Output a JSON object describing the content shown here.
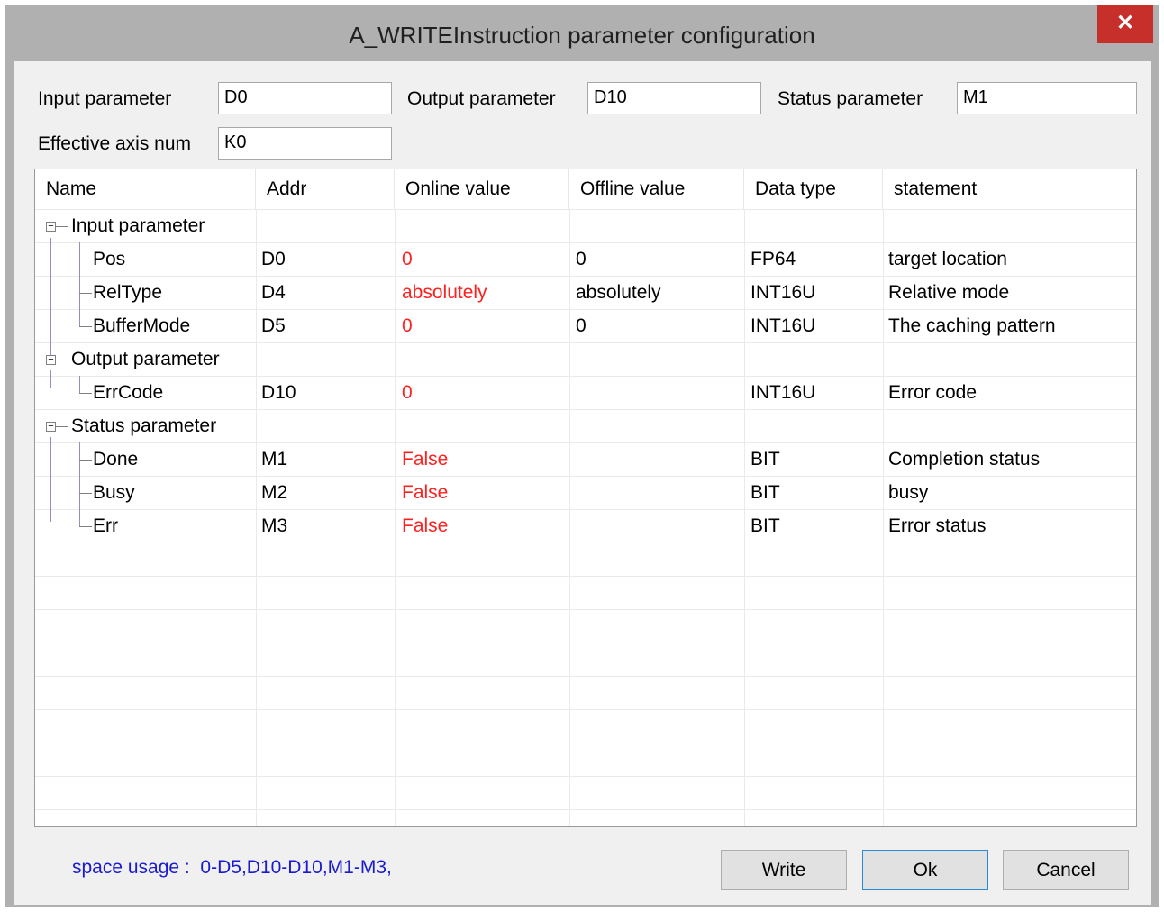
{
  "window": {
    "title": "A_WRITEInstruction parameter configuration",
    "close_glyph": "✕"
  },
  "params": {
    "input_label": "Input parameter",
    "input_value": "D0",
    "output_label": "Output parameter",
    "output_value": "D10",
    "status_label": "Status parameter",
    "status_value": "M1",
    "axis_label": "Effective axis num",
    "axis_value": "K0"
  },
  "table": {
    "columns": [
      "Name",
      "Addr",
      "Online value",
      "Offline value",
      "Data type",
      "statement"
    ],
    "groups": [
      {
        "label": "Input parameter",
        "expander": "−"
      },
      {
        "label": "Output parameter",
        "expander": "−"
      },
      {
        "label": "Status parameter",
        "expander": "−"
      }
    ],
    "rows": [
      {
        "name": "Pos",
        "addr": "D0",
        "online": "0",
        "offline": "0",
        "type": "FP64",
        "statement": "target location"
      },
      {
        "name": "RelType",
        "addr": "D4",
        "online": "absolutely",
        "offline": "absolutely",
        "type": "INT16U",
        "statement": "Relative mode"
      },
      {
        "name": "BufferMode",
        "addr": "D5",
        "online": "0",
        "offline": "0",
        "type": "INT16U",
        "statement": "The caching pattern"
      },
      {
        "name": "ErrCode",
        "addr": "D10",
        "online": "0",
        "offline": "",
        "type": "INT16U",
        "statement": "Error code"
      },
      {
        "name": "Done",
        "addr": "M1",
        "online": "False",
        "offline": "",
        "type": "BIT",
        "statement": "Completion status"
      },
      {
        "name": "Busy",
        "addr": "M2",
        "online": "False",
        "offline": "",
        "type": "BIT",
        "statement": "busy"
      },
      {
        "name": "Err",
        "addr": "M3",
        "online": "False",
        "offline": "",
        "type": "BIT",
        "statement": "Error status"
      }
    ]
  },
  "footer": {
    "space_usage": "space usage :  0-D5,D10-D10,M1-M3,",
    "write_label": "Write",
    "ok_label": "Ok",
    "cancel_label": "Cancel"
  },
  "colors": {
    "online_value": "#ff2020",
    "space_usage_text": "#1a1ad0",
    "close_button": "#c7302a"
  }
}
